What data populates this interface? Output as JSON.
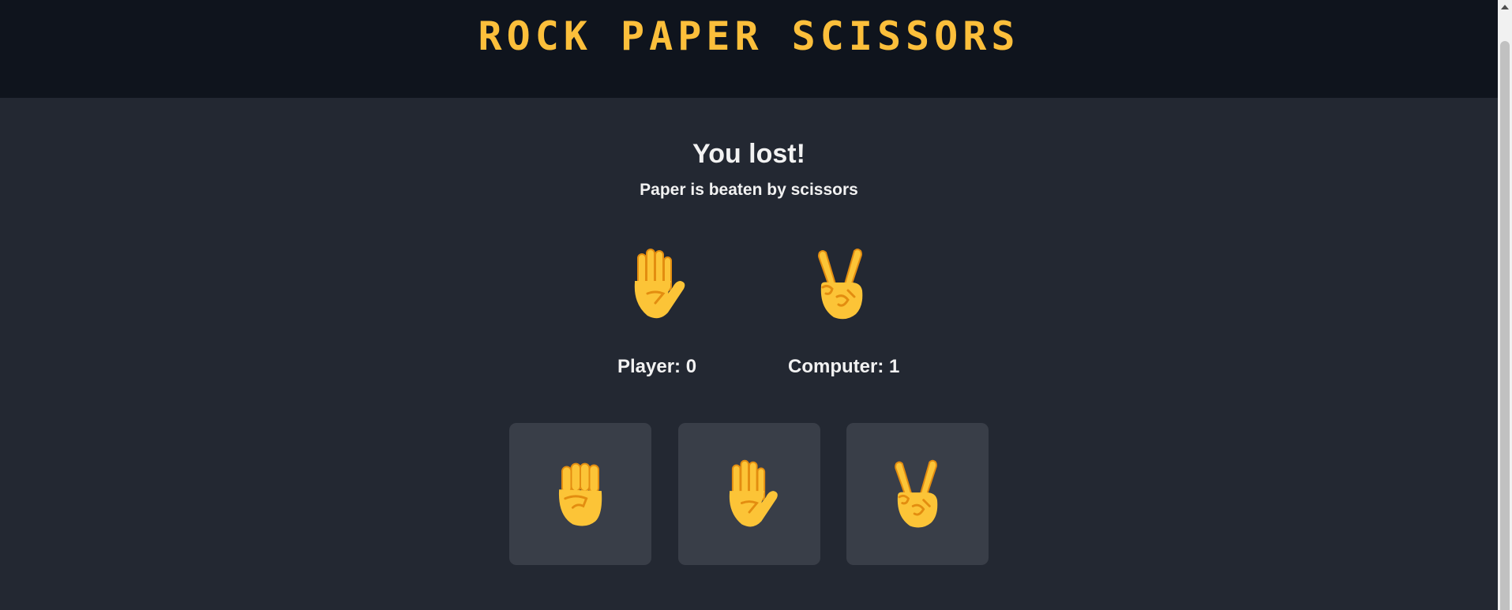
{
  "header": {
    "title": "ROCK PAPER SCISSORS"
  },
  "result": {
    "title": "You lost!",
    "message": "Paper is beaten by scissors"
  },
  "hands": {
    "player_icon": "raised-hand-icon",
    "computer_icon": "victory-hand-icon"
  },
  "scores": {
    "player_label": "Player: 0",
    "computer_label": "Computer: 1",
    "player": 0,
    "computer": 1
  },
  "choices": [
    {
      "id": "rock",
      "icon": "raised-fist-icon"
    },
    {
      "id": "paper",
      "icon": "raised-hand-icon"
    },
    {
      "id": "scissors",
      "icon": "victory-hand-icon"
    }
  ],
  "colors": {
    "header_bg": "#0f141d",
    "page_bg": "#232832",
    "title": "#fcbf3b",
    "card_bg": "#393e48",
    "text": "#f2f2f2",
    "emoji_skin": "#fcc437",
    "emoji_shade": "#e38d10"
  }
}
